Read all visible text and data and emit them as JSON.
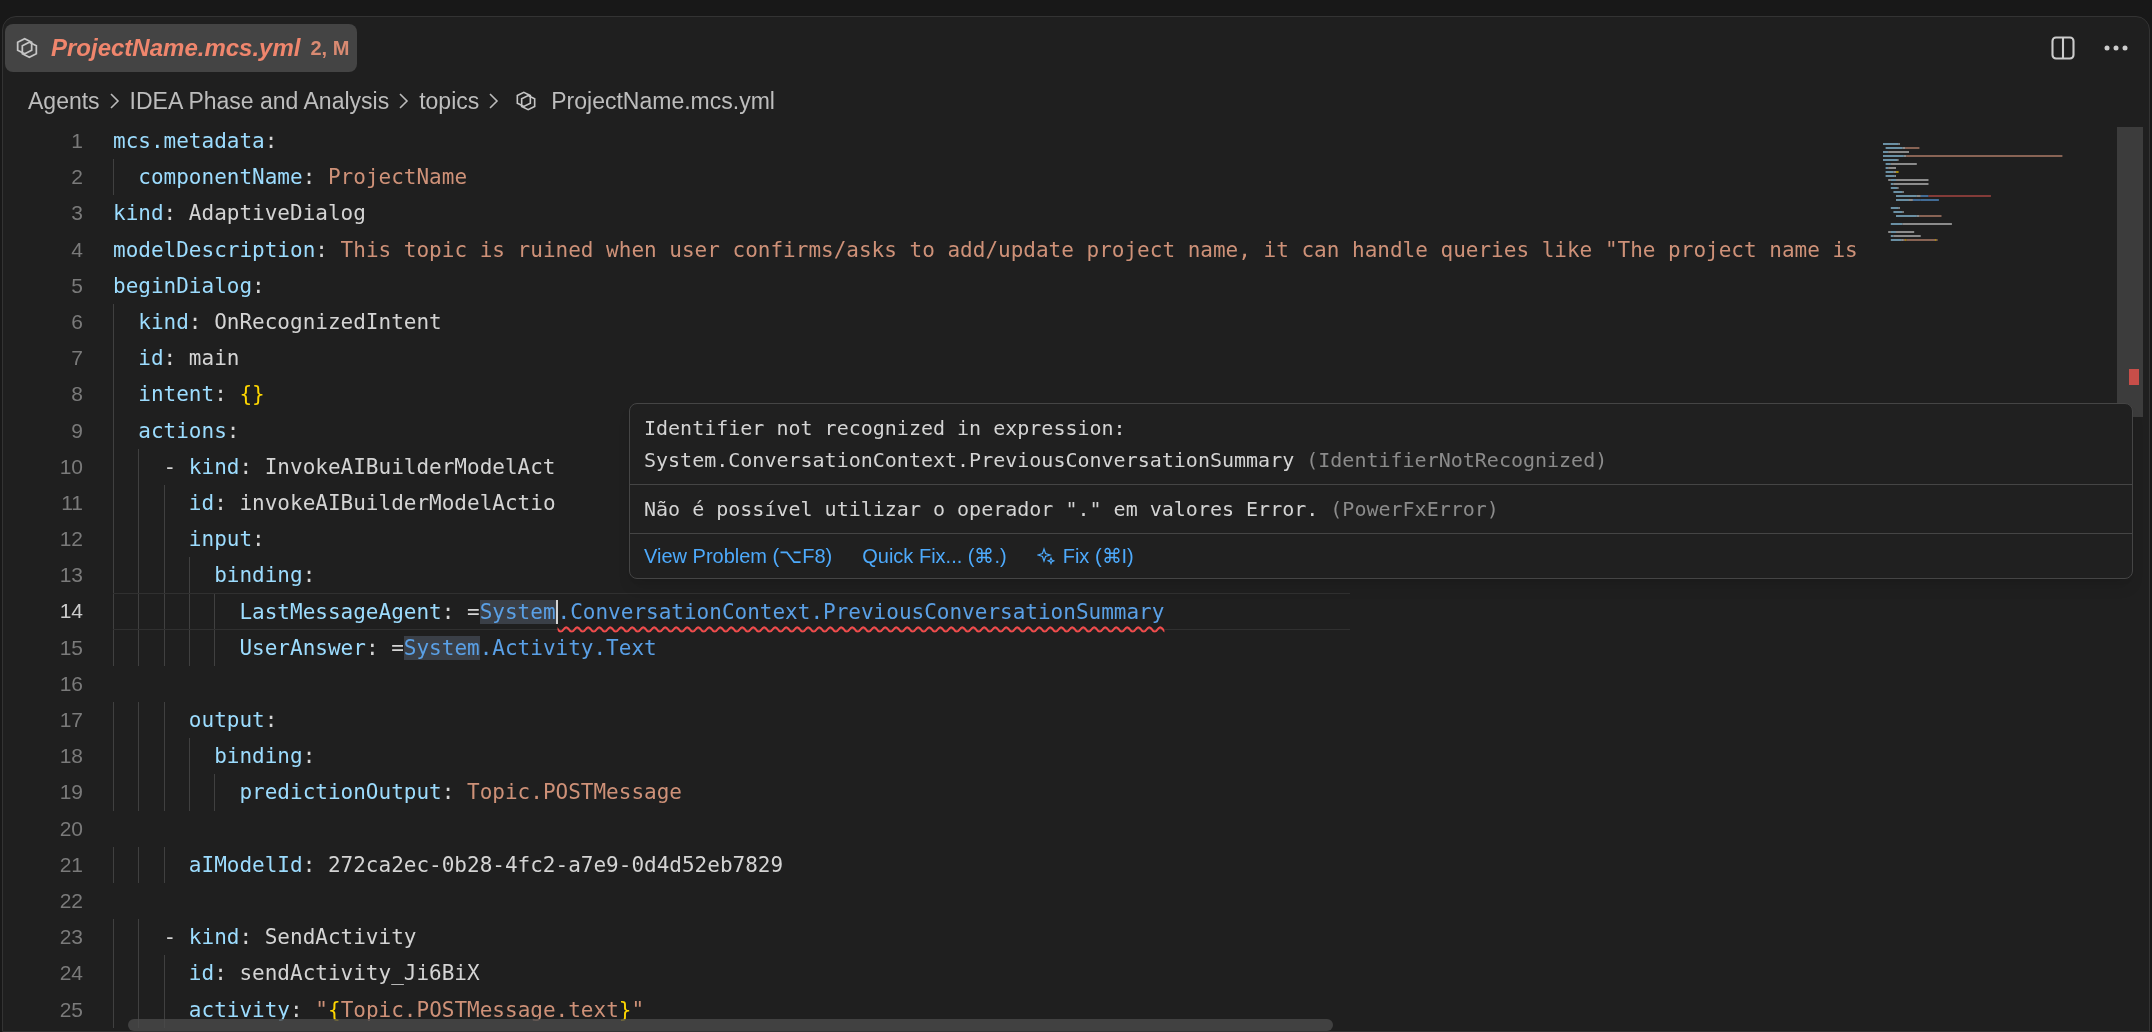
{
  "tab": {
    "title": "ProjectName.mcs.yml",
    "badge": "2, M",
    "selected": true
  },
  "breadcrumbs": [
    {
      "label": "Agents",
      "kind": "folder"
    },
    {
      "label": "IDEA Phase and Analysis",
      "kind": "folder"
    },
    {
      "label": "topics",
      "kind": "folder"
    },
    {
      "label": "ProjectName.mcs.yml",
      "kind": "file"
    }
  ],
  "lines": [
    {
      "number": "1",
      "current": false,
      "tokens": [
        {
          "text": "mcs.metadata",
          "kind": "key"
        },
        {
          "text": ":",
          "kind": "plain"
        }
      ]
    },
    {
      "number": "2",
      "current": false,
      "tokens": [
        {
          "text": "  componentName",
          "kind": "key"
        },
        {
          "text": ": ",
          "kind": "plain"
        },
        {
          "text": "ProjectName",
          "kind": "string"
        }
      ]
    },
    {
      "number": "3",
      "current": false,
      "tokens": [
        {
          "text": "kind",
          "kind": "key"
        },
        {
          "text": ": AdaptiveDialog",
          "kind": "plain"
        }
      ]
    },
    {
      "number": "4",
      "current": false,
      "tokens": [
        {
          "text": "modelDescription",
          "kind": "key"
        },
        {
          "text": ": ",
          "kind": "plain"
        },
        {
          "text": "This topic is ruined when user confirms/asks to add/update project name, it can handle queries like \"The project name is",
          "kind": "string"
        }
      ]
    },
    {
      "number": "5",
      "current": false,
      "tokens": [
        {
          "text": "beginDialog",
          "kind": "key"
        },
        {
          "text": ":",
          "kind": "plain"
        }
      ]
    },
    {
      "number": "6",
      "current": false,
      "tokens": [
        {
          "text": "  kind",
          "kind": "key"
        },
        {
          "text": ": OnRecognizedIntent",
          "kind": "plain"
        }
      ]
    },
    {
      "number": "7",
      "current": false,
      "tokens": [
        {
          "text": "  id",
          "kind": "key"
        },
        {
          "text": ": main",
          "kind": "plain"
        }
      ]
    },
    {
      "number": "8",
      "current": false,
      "tokens": [
        {
          "text": "  intent",
          "kind": "key"
        },
        {
          "text": ": ",
          "kind": "plain"
        },
        {
          "text": "{}",
          "kind": "brace"
        }
      ]
    },
    {
      "number": "9",
      "current": false,
      "tokens": [
        {
          "text": "  actions",
          "kind": "key"
        },
        {
          "text": ":",
          "kind": "plain"
        }
      ]
    },
    {
      "number": "10",
      "current": false,
      "tokens": [
        {
          "text": "    - ",
          "kind": "plain"
        },
        {
          "text": "kind",
          "kind": "key"
        },
        {
          "text": ": InvokeAIBuilderModelAct",
          "kind": "plain"
        }
      ]
    },
    {
      "number": "11",
      "current": false,
      "tokens": [
        {
          "text": "      id",
          "kind": "key"
        },
        {
          "text": ": invokeAIBuilderModelActio",
          "kind": "plain"
        }
      ]
    },
    {
      "number": "12",
      "current": false,
      "tokens": [
        {
          "text": "      input",
          "kind": "key"
        },
        {
          "text": ":",
          "kind": "plain"
        }
      ]
    },
    {
      "number": "13",
      "current": false,
      "tokens": [
        {
          "text": "        binding",
          "kind": "key"
        },
        {
          "text": ":",
          "kind": "plain"
        }
      ]
    },
    {
      "number": "14",
      "current": true,
      "tokens": [
        {
          "text": "          LastMessageAgent",
          "kind": "key"
        },
        {
          "text": ": =",
          "kind": "plain"
        },
        {
          "text": "System",
          "kind": "symbol",
          "highlighted": true,
          "cursor": true
        },
        {
          "text": ".ConversationContext.PreviousConversationSummary",
          "kind": "symbol",
          "error": true
        }
      ]
    },
    {
      "number": "15",
      "current": false,
      "tokens": [
        {
          "text": "          UserAnswer",
          "kind": "key"
        },
        {
          "text": ": =",
          "kind": "plain"
        },
        {
          "text": "System",
          "kind": "symbol",
          "highlighted": true
        },
        {
          "text": ".Activity.Text",
          "kind": "symbol"
        }
      ]
    },
    {
      "number": "16",
      "current": false
    },
    {
      "number": "17",
      "current": false,
      "tokens": [
        {
          "text": "      output",
          "kind": "key"
        },
        {
          "text": ":",
          "kind": "plain"
        }
      ]
    },
    {
      "number": "18",
      "current": false,
      "tokens": [
        {
          "text": "        binding",
          "kind": "key"
        },
        {
          "text": ":",
          "kind": "plain"
        }
      ]
    },
    {
      "number": "19",
      "current": false,
      "tokens": [
        {
          "text": "          predictionOutput",
          "kind": "key"
        },
        {
          "text": ": ",
          "kind": "plain"
        },
        {
          "text": "Topic.POSTMessage",
          "kind": "string"
        }
      ]
    },
    {
      "number": "20",
      "current": false
    },
    {
      "number": "21",
      "current": false,
      "tokens": [
        {
          "text": "      aIModelId",
          "kind": "key"
        },
        {
          "text": ": 272ca2ec-0b28-4fc2-a7e9-0d4d52eb7829",
          "kind": "plain"
        }
      ]
    },
    {
      "number": "22",
      "current": false
    },
    {
      "number": "23",
      "current": false,
      "tokens": [
        {
          "text": "    - ",
          "kind": "plain"
        },
        {
          "text": "kind",
          "kind": "key"
        },
        {
          "text": ": SendActivity",
          "kind": "plain"
        }
      ]
    },
    {
      "number": "24",
      "current": false,
      "tokens": [
        {
          "text": "      id",
          "kind": "key"
        },
        {
          "text": ": sendActivity_Ji6BiX",
          "kind": "plain"
        }
      ]
    },
    {
      "number": "25",
      "current": false,
      "tokens": [
        {
          "text": "      activity",
          "kind": "key"
        },
        {
          "text": ": ",
          "kind": "plain"
        },
        {
          "text": "\"",
          "kind": "string"
        },
        {
          "text": "{",
          "kind": "brace"
        },
        {
          "text": "Topic.POSTMessage.text",
          "kind": "string"
        },
        {
          "text": "}",
          "kind": "brace"
        },
        {
          "text": "\"",
          "kind": "string"
        }
      ]
    }
  ],
  "hover": {
    "problems": [
      {
        "message_lines": [
          "Identifier not recognized in expression:",
          "System.ConversationContext.PreviousConversationSummary"
        ],
        "code": "(IdentifierNotRecognized)"
      },
      {
        "message_lines": [
          "Não é possível utilizar o operador \".\" em valores Error."
        ],
        "code": "(PowerFxError)"
      }
    ],
    "actions": [
      {
        "label": "View Problem (⌥F8)",
        "kind": "link"
      },
      {
        "label": "Quick Fix... (⌘.)",
        "kind": "link"
      },
      {
        "label": "Fix (⌘I)",
        "kind": "ai"
      }
    ]
  }
}
